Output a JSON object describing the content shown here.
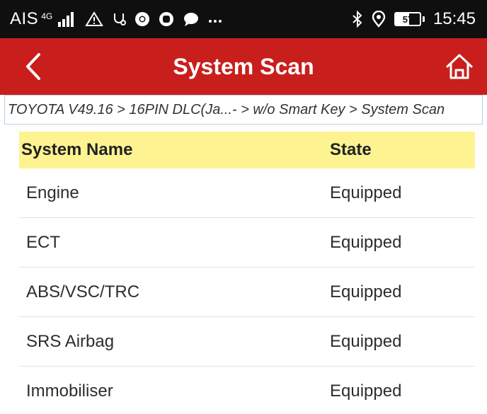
{
  "status_bar": {
    "carrier": "AIS",
    "network_type": "4G",
    "battery_level": 57,
    "battery_label": "57",
    "time": "15:45",
    "icons": [
      "signal-icon",
      "warning-icon",
      "usb-debug-icon",
      "chrome-icon",
      "app-icon",
      "chat-bubble-icon",
      "more-notifications-icon",
      "bluetooth-icon",
      "location-icon",
      "battery-icon"
    ]
  },
  "app_bar": {
    "title": "System Scan",
    "back_icon": "chevron-left-icon",
    "home_icon": "home-icon",
    "background_color": "#c81f1d"
  },
  "breadcrumb": {
    "text": "TOYOTA V49.16 > 16PIN DLC(Ja...- > w/o Smart Key > System Scan"
  },
  "table": {
    "header_color": "#fdf491",
    "headers": {
      "name": "System Name",
      "state": "State"
    },
    "rows": [
      {
        "name": "Engine",
        "state": "Equipped"
      },
      {
        "name": "ECT",
        "state": "Equipped"
      },
      {
        "name": "ABS/VSC/TRC",
        "state": "Equipped"
      },
      {
        "name": "SRS Airbag",
        "state": "Equipped"
      },
      {
        "name": "Immobiliser",
        "state": "Equipped"
      }
    ]
  }
}
